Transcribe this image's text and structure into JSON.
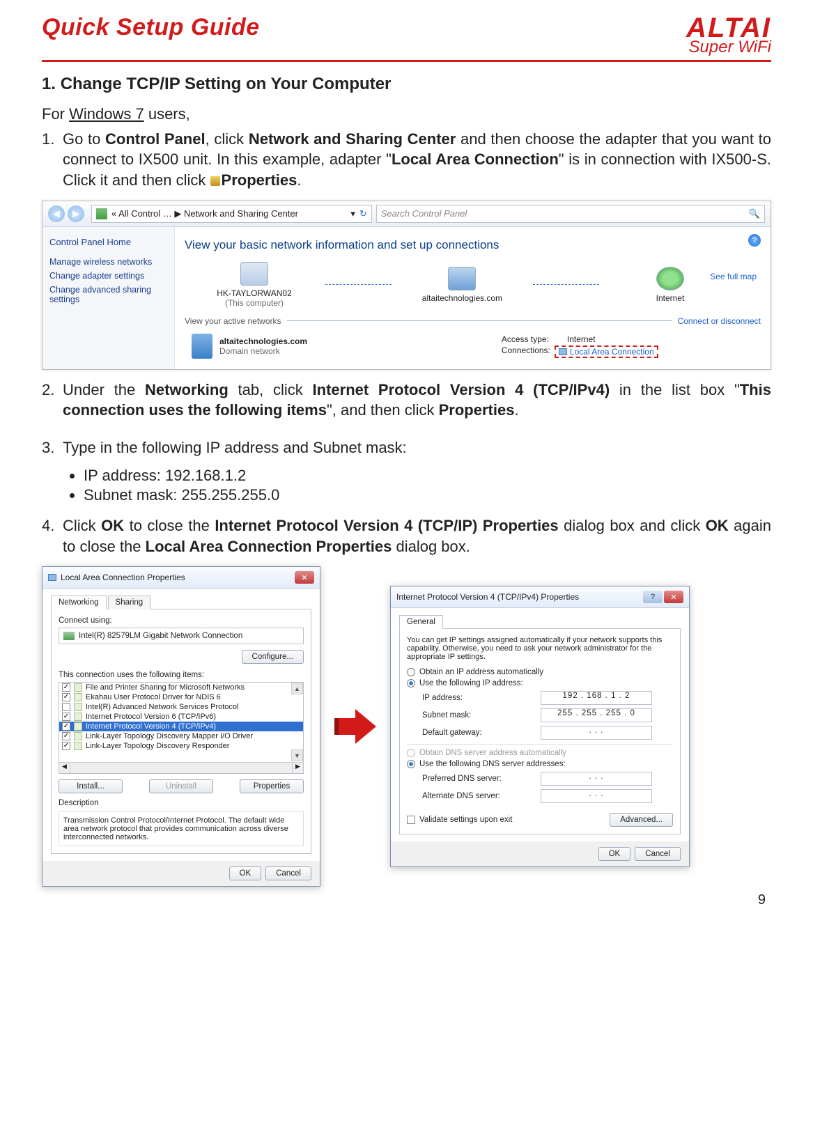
{
  "header": {
    "guide_title": "Quick Setup Guide",
    "brand": "ALTAI",
    "brand_sub": "Super WiFi"
  },
  "section": {
    "number": "1.",
    "title": "Change TCP/IP Setting on Your Computer",
    "intro_prefix": "For ",
    "intro_os": "Windows 7",
    "intro_suffix": " users,"
  },
  "step1": {
    "num": "1.",
    "t1": "Go to ",
    "b1": "Control Panel",
    "t2": ", click ",
    "b2": "Network and Sharing Center",
    "t3": " and then choose the adapter that you want to connect to IX500 unit. In this example, adapter \"",
    "b3": "Local Area Connection",
    "t4": "\" is in connection with IX500-S. Click it and then click ",
    "b4": "Properties",
    "t5": "."
  },
  "cp": {
    "breadcrumb_left": "« All Control …",
    "breadcrumb_sep": "▶",
    "breadcrumb_right": "Network and Sharing Center",
    "search_placeholder": "Search Control Panel",
    "sidebar_title": "Control Panel Home",
    "sidebar_links": [
      "Manage wireless networks",
      "Change adapter settings",
      "Change advanced sharing settings"
    ],
    "headline": "View your basic network information and set up connections",
    "see_full_map": "See full map",
    "node_computer": "HK-TAYLORWAN02",
    "node_computer_sub": "(This computer)",
    "node_network": "altaitechnologies.com",
    "node_internet": "Internet",
    "active_label": "View your active networks",
    "connect_disconnect": "Connect or disconnect",
    "domain_name": "altaitechnologies.com",
    "domain_type": "Domain network",
    "access_type_label": "Access type:",
    "access_type_value": "Internet",
    "connections_label": "Connections:",
    "connections_value": "Local Area Connection"
  },
  "step2": {
    "num": "2.",
    "t1": "Under the ",
    "b1": "Networking",
    "t2": " tab, click ",
    "b2": "Internet Protocol Version 4 (TCP/IPv4)",
    "t3": " in the list box \"",
    "b3": "This connection uses the following items",
    "t4": "\", and then click ",
    "b4": "Properties",
    "t5": "."
  },
  "step3": {
    "num": "3.",
    "text": "Type in the following IP address and Subnet mask:",
    "bullet_ip": "IP address: 192.168.1.2",
    "bullet_mask": "Subnet mask: 255.255.255.0"
  },
  "step4": {
    "num": "4.",
    "t1": "Click ",
    "b1": "OK",
    "t2": " to close the ",
    "b2": "Internet Protocol Version 4 (TCP/IP) Properties",
    "t3": " dialog box and click ",
    "b3": "OK",
    "t4": " again to close the ",
    "b4": "Local Area Connection Properties",
    "t5": " dialog box."
  },
  "dlg_lac": {
    "title": "Local Area Connection Properties",
    "tab1": "Networking",
    "tab2": "Sharing",
    "connect_using": "Connect using:",
    "adapter": "Intel(R) 82579LM Gigabit Network Connection",
    "configure": "Configure...",
    "list_label": "This connection uses the following items:",
    "items": [
      {
        "chk": true,
        "label": "File and Printer Sharing for Microsoft Networks"
      },
      {
        "chk": true,
        "label": "Ekahau User Protocol Driver for NDIS 6"
      },
      {
        "chk": false,
        "label": "Intel(R) Advanced Network Services Protocol"
      },
      {
        "chk": true,
        "label": "Internet Protocol Version 6 (TCP/IPv6)"
      },
      {
        "chk": true,
        "label": "Internet Protocol Version 4 (TCP/IPv4)"
      },
      {
        "chk": true,
        "label": "Link-Layer Topology Discovery Mapper I/O Driver"
      },
      {
        "chk": true,
        "label": "Link-Layer Topology Discovery Responder"
      }
    ],
    "install": "Install...",
    "uninstall": "Uninstall",
    "properties": "Properties",
    "desc_label": "Description",
    "desc_text": "Transmission Control Protocol/Internet Protocol. The default wide area network protocol that provides communication across diverse interconnected networks.",
    "ok": "OK",
    "cancel": "Cancel"
  },
  "dlg_ip": {
    "title": "Internet Protocol Version 4 (TCP/IPv4) Properties",
    "tab": "General",
    "info": "You can get IP settings assigned automatically if your network supports this capability. Otherwise, you need to ask your network administrator for the appropriate IP settings.",
    "r_auto_ip": "Obtain an IP address automatically",
    "r_use_ip": "Use the following IP address:",
    "ip_label": "IP address:",
    "ip_value": "192 . 168 .  1  .  2",
    "mask_label": "Subnet mask:",
    "mask_value": "255 . 255 . 255 .  0",
    "gw_label": "Default gateway:",
    "gw_value": ".       .       .",
    "r_auto_dns": "Obtain DNS server address automatically",
    "r_use_dns": "Use the following DNS server addresses:",
    "pref_dns_label": "Preferred DNS server:",
    "pref_dns_value": ".       .       .",
    "alt_dns_label": "Alternate DNS server:",
    "alt_dns_value": ".       .       .",
    "validate": "Validate settings upon exit",
    "advanced": "Advanced...",
    "ok": "OK",
    "cancel": "Cancel"
  },
  "page_number": "9"
}
